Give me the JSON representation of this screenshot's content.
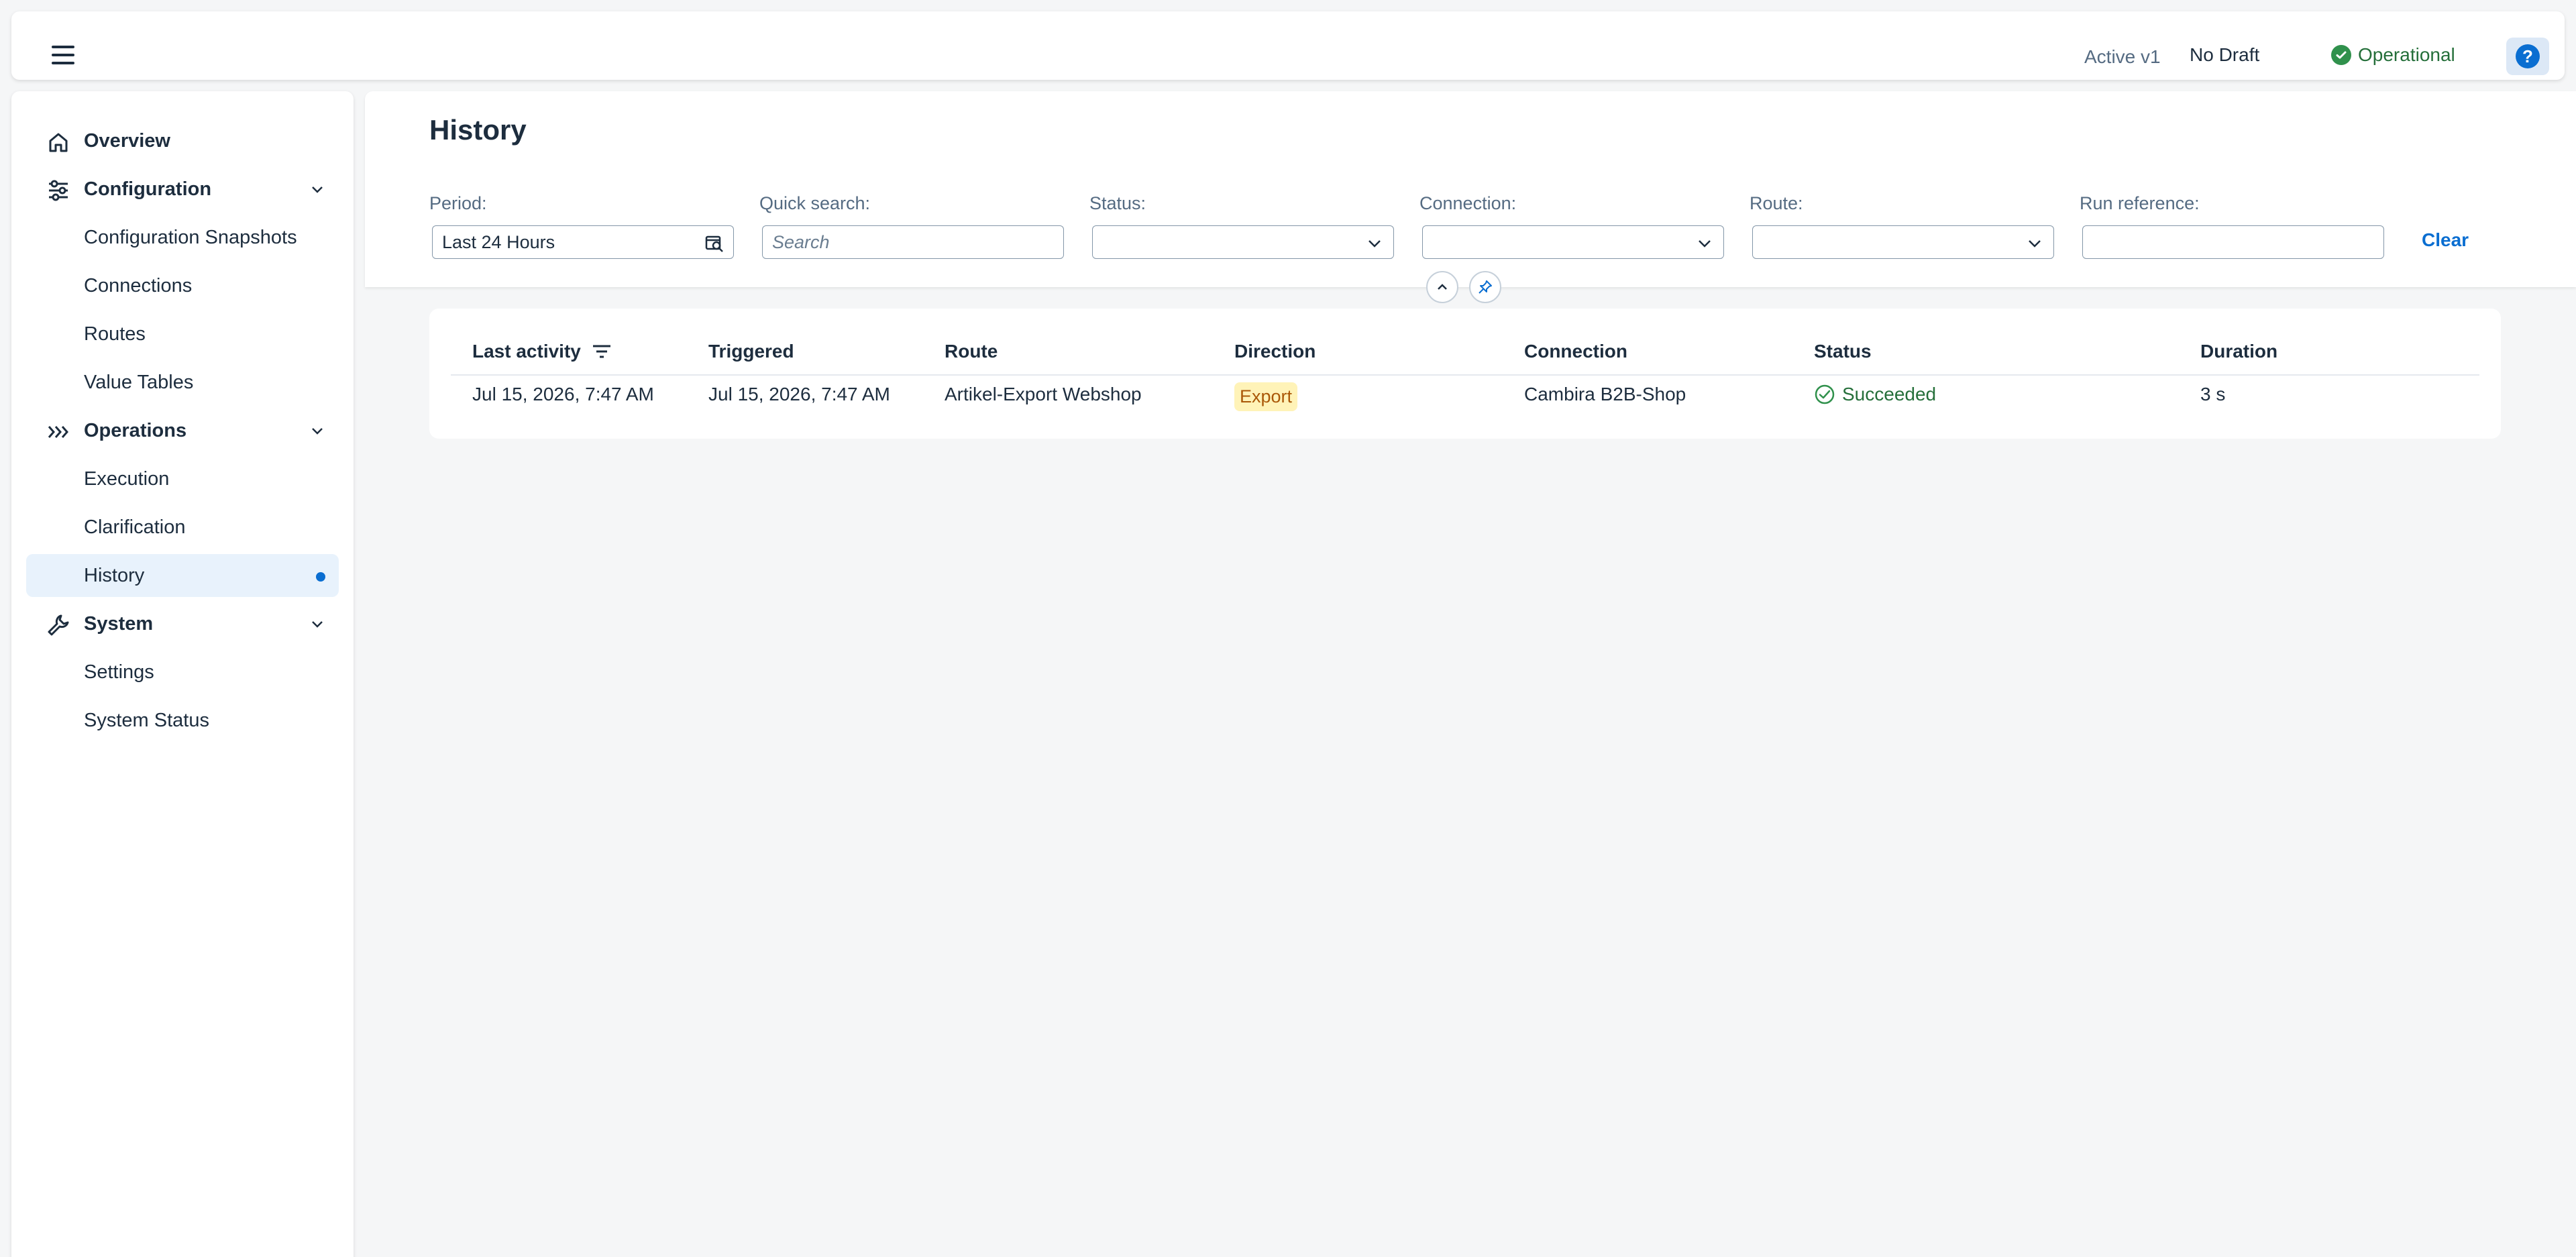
{
  "shell": {
    "version_label": "Active v1",
    "draft_label": "No Draft",
    "status_label": "Operational",
    "help_glyph": "?"
  },
  "sidebar": {
    "items": [
      {
        "label": "Overview",
        "icon": "home-icon",
        "type": "group"
      },
      {
        "label": "Configuration",
        "icon": "sliders-icon",
        "type": "group",
        "expanded": true
      },
      {
        "label": "Configuration Snapshots",
        "type": "child"
      },
      {
        "label": "Connections",
        "type": "child"
      },
      {
        "label": "Routes",
        "type": "child"
      },
      {
        "label": "Value Tables",
        "type": "child"
      },
      {
        "label": "Operations",
        "icon": "chevrons-right-icon",
        "type": "group",
        "expanded": true
      },
      {
        "label": "Execution",
        "type": "child"
      },
      {
        "label": "Clarification",
        "type": "child"
      },
      {
        "label": "History",
        "type": "child",
        "selected": true
      },
      {
        "label": "System",
        "icon": "wrench-icon",
        "type": "group",
        "expanded": true
      },
      {
        "label": "Settings",
        "type": "child"
      },
      {
        "label": "System Status",
        "type": "child"
      }
    ]
  },
  "page": {
    "title": "History"
  },
  "filters": {
    "period": {
      "label": "Period:",
      "value": "Last 24 Hours"
    },
    "quick_search": {
      "label": "Quick search:",
      "placeholder": "Search"
    },
    "status": {
      "label": "Status:",
      "value": ""
    },
    "connection": {
      "label": "Connection:",
      "value": ""
    },
    "route": {
      "label": "Route:",
      "value": ""
    },
    "run_reference": {
      "label": "Run reference:",
      "value": ""
    },
    "clear_label": "Clear"
  },
  "table": {
    "columns": [
      "Last activity",
      "Triggered",
      "Route",
      "Direction",
      "Connection",
      "Status",
      "Duration"
    ],
    "rows": [
      {
        "last_activity": "Jul 15, 2026, 7:47 AM",
        "triggered": "Jul 15, 2026, 7:47 AM",
        "route": "Artikel-Export Webshop",
        "direction": "Export",
        "connection": "Cambira B2B-Shop",
        "status": "Succeeded",
        "duration": "3 s"
      }
    ]
  },
  "colors": {
    "accent": "#0a6ed1",
    "success": "#256f3a",
    "export_badge_bg": "#fff3b8",
    "export_badge_fg": "#aa5808"
  }
}
